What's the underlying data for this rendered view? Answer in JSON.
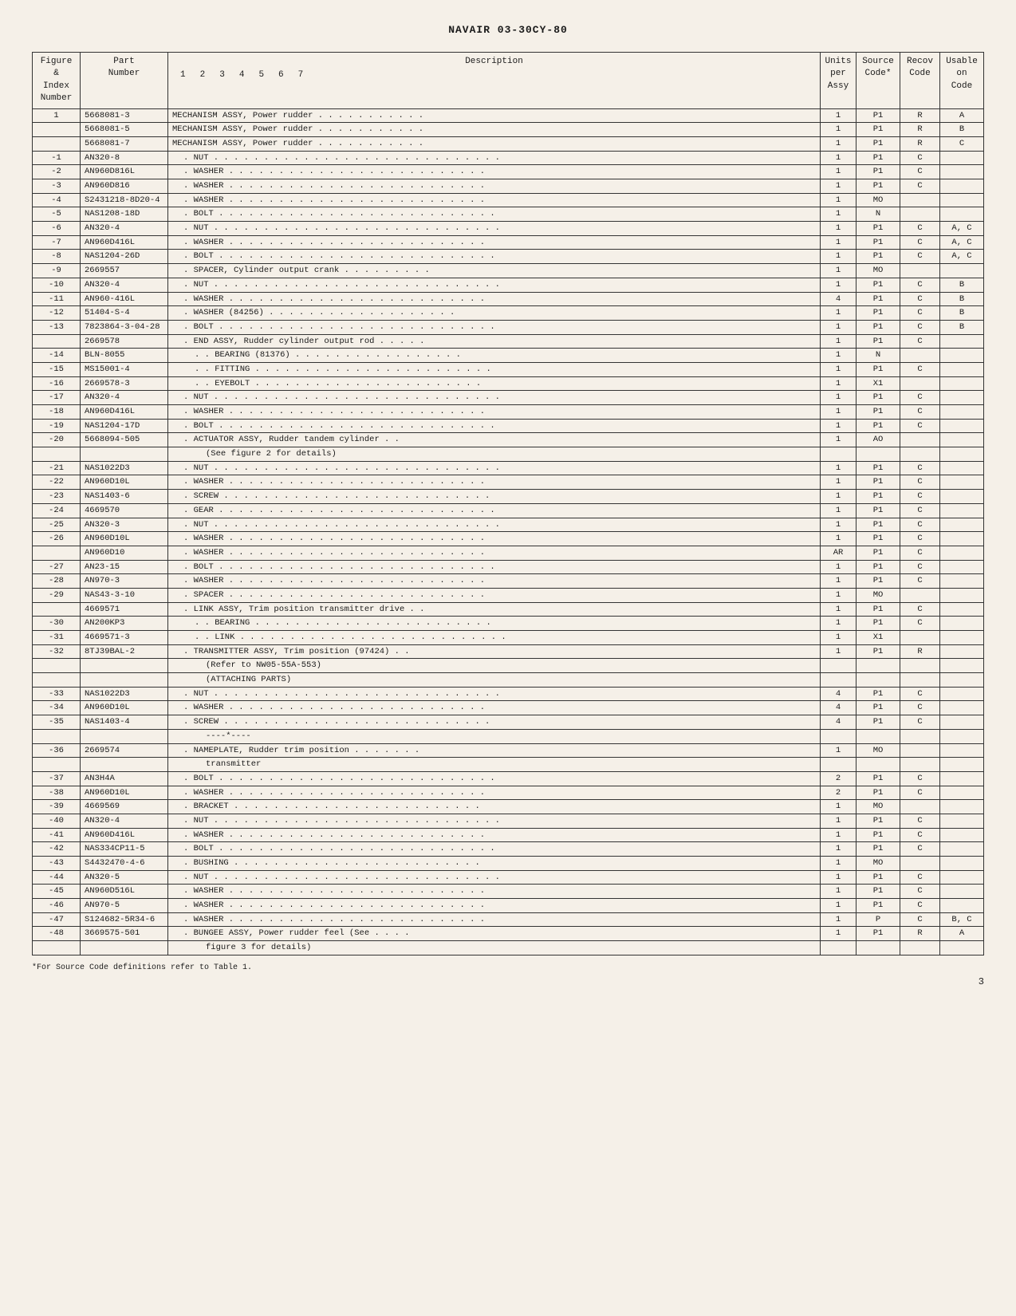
{
  "header": {
    "title": "NAVAIR 03-30CY-80"
  },
  "table": {
    "columns": {
      "fig_index": {
        "line1": "Figure &",
        "line2": "Index",
        "line3": "Number"
      },
      "part_number": {
        "line1": "Part",
        "line2": "Number"
      },
      "description": {
        "line1": "Description",
        "numbers": [
          "1",
          "2",
          "3",
          "4",
          "5",
          "6",
          "7"
        ]
      },
      "units_per_assy": {
        "line1": "Units",
        "line2": "per",
        "line3": "Assy"
      },
      "source_code": {
        "line1": "Source",
        "line2": "Code*"
      },
      "recov_code": {
        "line1": "Recov",
        "line2": "Code"
      },
      "usable_on_code": {
        "line1": "Usable",
        "line2": "on",
        "line3": "Code"
      }
    },
    "rows": [
      {
        "fig": "1",
        "part": "5668081-3",
        "desc": "MECHANISM ASSY, Power rudder . . . . . . . . . . .",
        "indent": 0,
        "units": "1",
        "source": "P1",
        "recov": "R",
        "usable": "A"
      },
      {
        "fig": "",
        "part": "5668081-5",
        "desc": "MECHANISM ASSY, Power rudder . . . . . . . . . . .",
        "indent": 0,
        "units": "1",
        "source": "P1",
        "recov": "R",
        "usable": "B"
      },
      {
        "fig": "",
        "part": "5668081-7",
        "desc": "MECHANISM ASSY, Power rudder . . . . . . . . . . .",
        "indent": 0,
        "units": "1",
        "source": "P1",
        "recov": "R",
        "usable": "C"
      },
      {
        "fig": "-1",
        "part": "AN320-8",
        "desc": ". NUT . . . . . . . . . . . . . . . . . . . . . . . . . . . . .",
        "indent": 1,
        "units": "1",
        "source": "P1",
        "recov": "C",
        "usable": ""
      },
      {
        "fig": "-2",
        "part": "AN960D816L",
        "desc": ". WASHER . . . . . . . . . . . . . . . . . . . . . . . . . .",
        "indent": 1,
        "units": "1",
        "source": "P1",
        "recov": "C",
        "usable": ""
      },
      {
        "fig": "-3",
        "part": "AN960D816",
        "desc": ". WASHER . . . . . . . . . . . . . . . . . . . . . . . . . .",
        "indent": 1,
        "units": "1",
        "source": "P1",
        "recov": "C",
        "usable": ""
      },
      {
        "fig": "-4",
        "part": "S2431218-8D20-4",
        "desc": ". WASHER . . . . . . . . . . . . . . . . . . . . . . . . . .",
        "indent": 1,
        "units": "1",
        "source": "MO",
        "recov": "",
        "usable": ""
      },
      {
        "fig": "-5",
        "part": "NAS1208-18D",
        "desc": ". BOLT . . . . . . . . . . . . . . . . . . . . . . . . . . . .",
        "indent": 1,
        "units": "1",
        "source": "N",
        "recov": "",
        "usable": ""
      },
      {
        "fig": "-6",
        "part": "AN320-4",
        "desc": ". NUT . . . . . . . . . . . . . . . . . . . . . . . . . . . . .",
        "indent": 1,
        "units": "1",
        "source": "P1",
        "recov": "C",
        "usable": "A, C"
      },
      {
        "fig": "-7",
        "part": "AN960D416L",
        "desc": ". WASHER . . . . . . . . . . . . . . . . . . . . . . . . . .",
        "indent": 1,
        "units": "1",
        "source": "P1",
        "recov": "C",
        "usable": "A, C"
      },
      {
        "fig": "-8",
        "part": "NAS1204-26D",
        "desc": ". BOLT . . . . . . . . . . . . . . . . . . . . . . . . . . . .",
        "indent": 1,
        "units": "1",
        "source": "P1",
        "recov": "C",
        "usable": "A, C"
      },
      {
        "fig": "-9",
        "part": "2669557",
        "desc": ". SPACER, Cylinder output crank . . . . . . . . .",
        "indent": 1,
        "units": "1",
        "source": "MO",
        "recov": "",
        "usable": ""
      },
      {
        "fig": "-10",
        "part": "AN320-4",
        "desc": ". NUT . . . . . . . . . . . . . . . . . . . . . . . . . . . . .",
        "indent": 1,
        "units": "1",
        "source": "P1",
        "recov": "C",
        "usable": "B"
      },
      {
        "fig": "-11",
        "part": "AN960-416L",
        "desc": ". WASHER . . . . . . . . . . . . . . . . . . . . . . . . . .",
        "indent": 1,
        "units": "4",
        "source": "P1",
        "recov": "C",
        "usable": "B"
      },
      {
        "fig": "-12",
        "part": "51404-S-4",
        "desc": ". WASHER (84256) . . . . . . . . . . . . . . . . . . .",
        "indent": 1,
        "units": "1",
        "source": "P1",
        "recov": "C",
        "usable": "B"
      },
      {
        "fig": "-13",
        "part": "7823864-3-04-28",
        "desc": ". BOLT . . . . . . . . . . . . . . . . . . . . . . . . . . . .",
        "indent": 1,
        "units": "1",
        "source": "P1",
        "recov": "C",
        "usable": "B"
      },
      {
        "fig": "",
        "part": "2669578",
        "desc": ". END ASSY, Rudder cylinder output rod . . . . .",
        "indent": 1,
        "units": "1",
        "source": "P1",
        "recov": "C",
        "usable": ""
      },
      {
        "fig": "-14",
        "part": "BLN-8055",
        "desc": ". . BEARING (81376) . . . . . . . . . . . . . . . . .",
        "indent": 2,
        "units": "1",
        "source": "N",
        "recov": "",
        "usable": ""
      },
      {
        "fig": "-15",
        "part": "MS15001-4",
        "desc": ". . FITTING . . . . . . . . . . . . . . . . . . . . . . . .",
        "indent": 2,
        "units": "1",
        "source": "P1",
        "recov": "C",
        "usable": ""
      },
      {
        "fig": "-16",
        "part": "2669578-3",
        "desc": ". . EYEBOLT . . . . . . . . . . . . . . . . . . . . . . .",
        "indent": 2,
        "units": "1",
        "source": "X1",
        "recov": "",
        "usable": ""
      },
      {
        "fig": "-17",
        "part": "AN320-4",
        "desc": ". NUT . . . . . . . . . . . . . . . . . . . . . . . . . . . . .",
        "indent": 1,
        "units": "1",
        "source": "P1",
        "recov": "C",
        "usable": ""
      },
      {
        "fig": "-18",
        "part": "AN960D416L",
        "desc": ". WASHER . . . . . . . . . . . . . . . . . . . . . . . . . .",
        "indent": 1,
        "units": "1",
        "source": "P1",
        "recov": "C",
        "usable": ""
      },
      {
        "fig": "-19",
        "part": "NAS1204-17D",
        "desc": ". BOLT . . . . . . . . . . . . . . . . . . . . . . . . . . . .",
        "indent": 1,
        "units": "1",
        "source": "P1",
        "recov": "C",
        "usable": ""
      },
      {
        "fig": "-20",
        "part": "5668094-505",
        "desc": ". ACTUATOR ASSY, Rudder tandem cylinder . .",
        "indent": 1,
        "units": "1",
        "source": "AO",
        "recov": "",
        "usable": ""
      },
      {
        "fig": "",
        "part": "",
        "desc": "(See figure 2 for details)",
        "indent": 3,
        "units": "",
        "source": "",
        "recov": "",
        "usable": ""
      },
      {
        "fig": "-21",
        "part": "NAS1022D3",
        "desc": ". NUT . . . . . . . . . . . . . . . . . . . . . . . . . . . . .",
        "indent": 1,
        "units": "1",
        "source": "P1",
        "recov": "C",
        "usable": ""
      },
      {
        "fig": "-22",
        "part": "AN960D10L",
        "desc": ". WASHER . . . . . . . . . . . . . . . . . . . . . . . . . .",
        "indent": 1,
        "units": "1",
        "source": "P1",
        "recov": "C",
        "usable": ""
      },
      {
        "fig": "-23",
        "part": "NAS1403-6",
        "desc": ". SCREW . . . . . . . . . . . . . . . . . . . . . . . . . . .",
        "indent": 1,
        "units": "1",
        "source": "P1",
        "recov": "C",
        "usable": ""
      },
      {
        "fig": "-24",
        "part": "4669570",
        "desc": ". GEAR . . . . . . . . . . . . . . . . . . . . . . . . . . . .",
        "indent": 1,
        "units": "1",
        "source": "P1",
        "recov": "C",
        "usable": ""
      },
      {
        "fig": "-25",
        "part": "AN320-3",
        "desc": ". NUT . . . . . . . . . . . . . . . . . . . . . . . . . . . . .",
        "indent": 1,
        "units": "1",
        "source": "P1",
        "recov": "C",
        "usable": ""
      },
      {
        "fig": "-26",
        "part": "AN960D10L",
        "desc": ". WASHER . . . . . . . . . . . . . . . . . . . . . . . . . .",
        "indent": 1,
        "units": "1",
        "source": "P1",
        "recov": "C",
        "usable": ""
      },
      {
        "fig": "",
        "part": "AN960D10",
        "desc": ". WASHER . . . . . . . . . . . . . . . . . . . . . . . . . .",
        "indent": 1,
        "units": "AR",
        "source": "P1",
        "recov": "C",
        "usable": ""
      },
      {
        "fig": "-27",
        "part": "AN23-15",
        "desc": ". BOLT . . . . . . . . . . . . . . . . . . . . . . . . . . . .",
        "indent": 1,
        "units": "1",
        "source": "P1",
        "recov": "C",
        "usable": ""
      },
      {
        "fig": "-28",
        "part": "AN970-3",
        "desc": ". WASHER . . . . . . . . . . . . . . . . . . . . . . . . . .",
        "indent": 1,
        "units": "1",
        "source": "P1",
        "recov": "C",
        "usable": ""
      },
      {
        "fig": "-29",
        "part": "NAS43-3-10",
        "desc": ". SPACER . . . . . . . . . . . . . . . . . . . . . . . . . .",
        "indent": 1,
        "units": "1",
        "source": "MO",
        "recov": "",
        "usable": ""
      },
      {
        "fig": "",
        "part": "4669571",
        "desc": ". LINK ASSY, Trim position transmitter drive . .",
        "indent": 1,
        "units": "1",
        "source": "P1",
        "recov": "C",
        "usable": ""
      },
      {
        "fig": "-30",
        "part": "AN200KP3",
        "desc": ". . BEARING . . . . . . . . . . . . . . . . . . . . . . . .",
        "indent": 2,
        "units": "1",
        "source": "P1",
        "recov": "C",
        "usable": ""
      },
      {
        "fig": "-31",
        "part": "4669571-3",
        "desc": ". . LINK . . . . . . . . . . . . . . . . . . . . . . . . . . .",
        "indent": 2,
        "units": "1",
        "source": "X1",
        "recov": "",
        "usable": ""
      },
      {
        "fig": "-32",
        "part": "8TJ39BAL-2",
        "desc": ". TRANSMITTER ASSY, Trim position (97424) . .",
        "indent": 1,
        "units": "1",
        "source": "P1",
        "recov": "R",
        "usable": ""
      },
      {
        "fig": "",
        "part": "",
        "desc": "(Refer to NW05-55A-553)",
        "indent": 3,
        "units": "",
        "source": "",
        "recov": "",
        "usable": ""
      },
      {
        "fig": "",
        "part": "",
        "desc": "(ATTACHING PARTS)",
        "indent": 3,
        "units": "",
        "source": "",
        "recov": "",
        "usable": ""
      },
      {
        "fig": "-33",
        "part": "NAS1022D3",
        "desc": ". NUT . . . . . . . . . . . . . . . . . . . . . . . . . . . . .",
        "indent": 1,
        "units": "4",
        "source": "P1",
        "recov": "C",
        "usable": ""
      },
      {
        "fig": "-34",
        "part": "AN960D10L",
        "desc": ". WASHER . . . . . . . . . . . . . . . . . . . . . . . . . .",
        "indent": 1,
        "units": "4",
        "source": "P1",
        "recov": "C",
        "usable": ""
      },
      {
        "fig": "-35",
        "part": "NAS1403-4",
        "desc": ". SCREW . . . . . . . . . . . . . . . . . . . . . . . . . . .",
        "indent": 1,
        "units": "4",
        "source": "P1",
        "recov": "C",
        "usable": ""
      },
      {
        "fig": "",
        "part": "",
        "desc": "----*----",
        "indent": 3,
        "units": "",
        "source": "",
        "recov": "",
        "usable": ""
      },
      {
        "fig": "-36",
        "part": "2669574",
        "desc": ". NAMEPLATE, Rudder trim position . . . . . . .",
        "indent": 1,
        "units": "1",
        "source": "MO",
        "recov": "",
        "usable": ""
      },
      {
        "fig": "",
        "part": "",
        "desc": "transmitter",
        "indent": 3,
        "units": "",
        "source": "",
        "recov": "",
        "usable": ""
      },
      {
        "fig": "-37",
        "part": "AN3H4A",
        "desc": ". BOLT . . . . . . . . . . . . . . . . . . . . . . . . . . . .",
        "indent": 1,
        "units": "2",
        "source": "P1",
        "recov": "C",
        "usable": ""
      },
      {
        "fig": "-38",
        "part": "AN960D10L",
        "desc": ". WASHER . . . . . . . . . . . . . . . . . . . . . . . . . .",
        "indent": 1,
        "units": "2",
        "source": "P1",
        "recov": "C",
        "usable": ""
      },
      {
        "fig": "-39",
        "part": "4669569",
        "desc": ". BRACKET . . . . . . . . . . . . . . . . . . . . . . . . .",
        "indent": 1,
        "units": "1",
        "source": "MO",
        "recov": "",
        "usable": ""
      },
      {
        "fig": "-40",
        "part": "AN320-4",
        "desc": ". NUT . . . . . . . . . . . . . . . . . . . . . . . . . . . . .",
        "indent": 1,
        "units": "1",
        "source": "P1",
        "recov": "C",
        "usable": ""
      },
      {
        "fig": "-41",
        "part": "AN960D416L",
        "desc": ". WASHER . . . . . . . . . . . . . . . . . . . . . . . . . .",
        "indent": 1,
        "units": "1",
        "source": "P1",
        "recov": "C",
        "usable": ""
      },
      {
        "fig": "-42",
        "part": "NAS334CP11-5",
        "desc": ". BOLT . . . . . . . . . . . . . . . . . . . . . . . . . . . .",
        "indent": 1,
        "units": "1",
        "source": "P1",
        "recov": "C",
        "usable": ""
      },
      {
        "fig": "-43",
        "part": "S4432470-4-6",
        "desc": ". BUSHING . . . . . . . . . . . . . . . . . . . . . . . . .",
        "indent": 1,
        "units": "1",
        "source": "MO",
        "recov": "",
        "usable": ""
      },
      {
        "fig": "-44",
        "part": "AN320-5",
        "desc": ". NUT . . . . . . . . . . . . . . . . . . . . . . . . . . . . .",
        "indent": 1,
        "units": "1",
        "source": "P1",
        "recov": "C",
        "usable": ""
      },
      {
        "fig": "-45",
        "part": "AN960D516L",
        "desc": ". WASHER . . . . . . . . . . . . . . . . . . . . . . . . . .",
        "indent": 1,
        "units": "1",
        "source": "P1",
        "recov": "C",
        "usable": ""
      },
      {
        "fig": "-46",
        "part": "AN970-5",
        "desc": ". WASHER . . . . . . . . . . . . . . . . . . . . . . . . . .",
        "indent": 1,
        "units": "1",
        "source": "P1",
        "recov": "C",
        "usable": ""
      },
      {
        "fig": "-47",
        "part": "S124682-5R34-6",
        "desc": ". WASHER . . . . . . . . . . . . . . . . . . . . . . . . . .",
        "indent": 1,
        "units": "1",
        "source": "P",
        "recov": "C",
        "usable": "B, C"
      },
      {
        "fig": "-48",
        "part": "3669575-501",
        "desc": ". BUNGEE ASSY, Power rudder feel (See . . . .",
        "indent": 1,
        "units": "1",
        "source": "P1",
        "recov": "R",
        "usable": "A"
      },
      {
        "fig": "",
        "part": "",
        "desc": "figure 3 for details)",
        "indent": 3,
        "units": "",
        "source": "",
        "recov": "",
        "usable": ""
      }
    ]
  },
  "footer": {
    "source_note": "*For Source Code definitions refer to Table 1.",
    "page_number": "3"
  }
}
